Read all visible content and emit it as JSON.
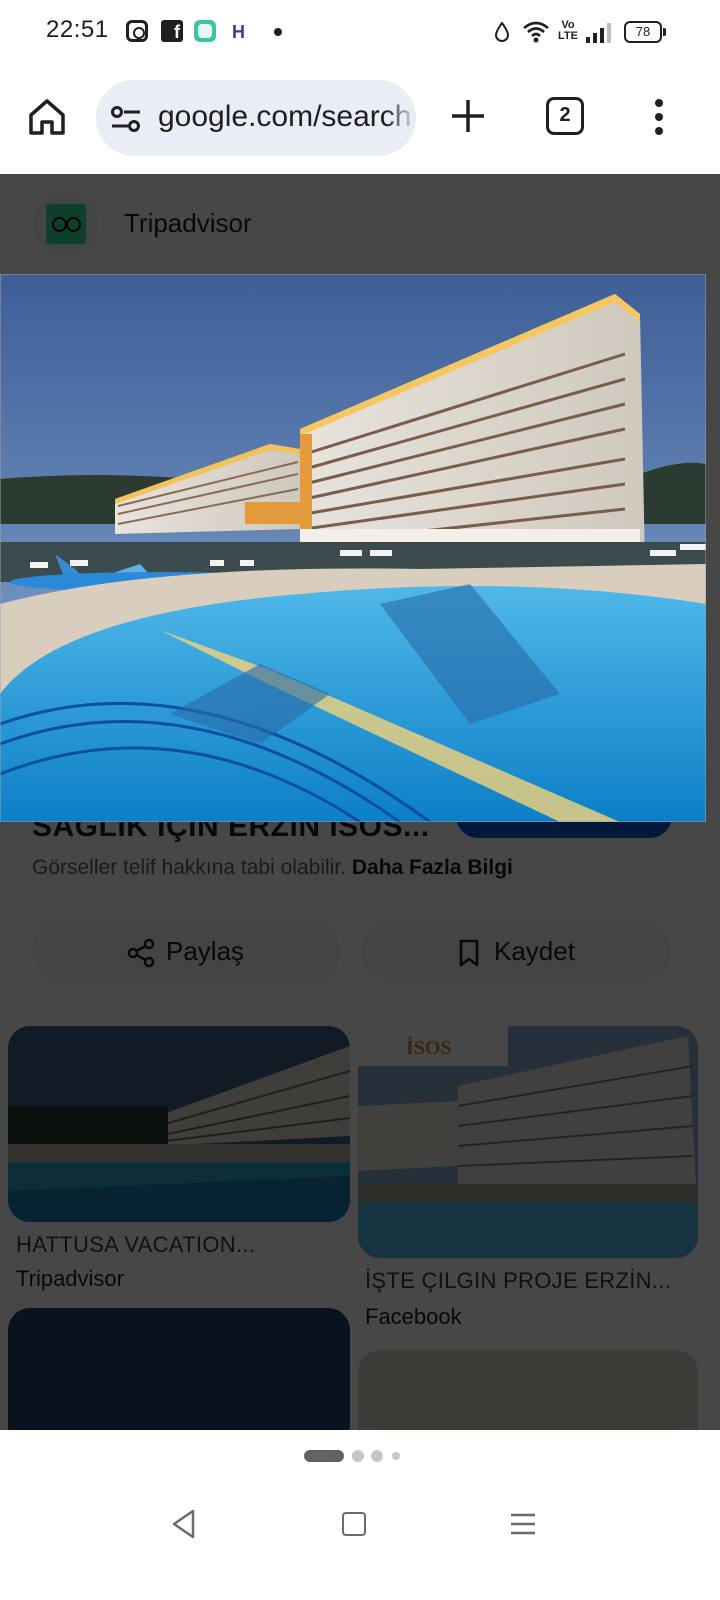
{
  "status_bar": {
    "time": "22:51",
    "notification_icons": [
      "instagram-icon",
      "facebook-icon",
      "app-icon",
      "h-icon",
      "dot-icon"
    ],
    "h_icon_letter": "H",
    "facebook_letter": "f",
    "volte_label": "Vo LTE",
    "battery": "78"
  },
  "browser": {
    "url": "google.com/search",
    "tab_count": "2"
  },
  "image_viewer": {
    "source_name": "Tripadvisor",
    "title_partial": "SAĞLIK İÇİN ERZİN İSOS...",
    "copyright_text": "Görseller telif hakkına tabi olabilir.",
    "learn_more": "Daha Fazla Bilgi",
    "share_label": "Paylaş",
    "save_label": "Kaydet"
  },
  "related_results": [
    {
      "title": "HATTUSA VACATION...",
      "source": "Tripadvisor"
    },
    {
      "title": "İŞTE ÇILGIN PROJE ERZİN...",
      "source": "Facebook",
      "logo_text": "İSOS"
    }
  ],
  "colors": {
    "accent_blue": "#0b57d0",
    "url_bar_bg": "#e8edf6",
    "tripadvisor_green": "#34e0a1"
  }
}
